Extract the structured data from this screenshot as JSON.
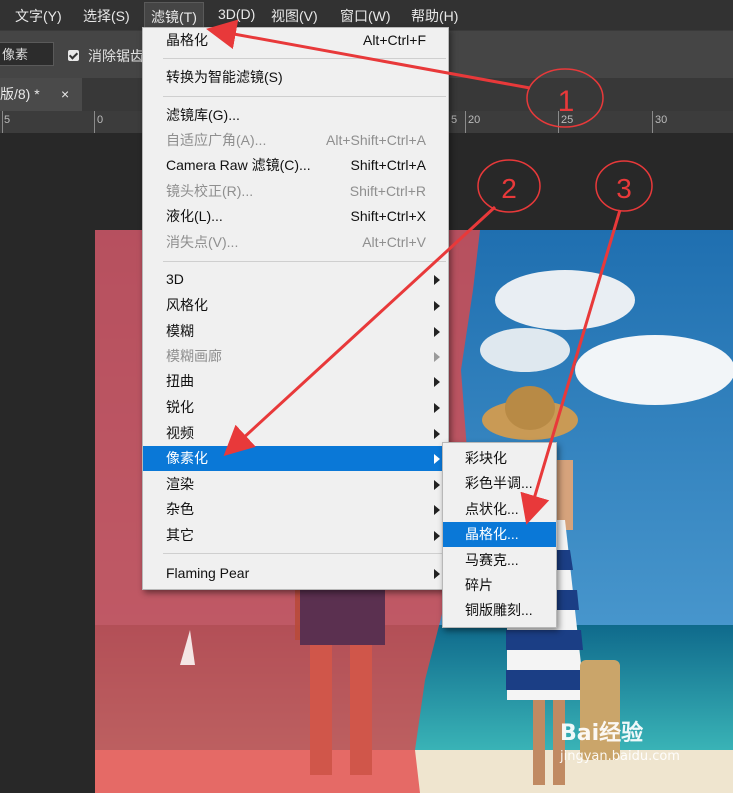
{
  "menubar": {
    "items": [
      "文字(Y)",
      "选择(S)",
      "滤镜(T)",
      "3D(D)",
      "视图(V)",
      "窗口(W)",
      "帮助(H)"
    ]
  },
  "options_bar": {
    "field_value": "像素",
    "checkbox_label": "消除锯齿"
  },
  "document_tab": {
    "title": "版/8) *",
    "close": "×"
  },
  "ruler": {
    "labels": [
      "5",
      "0",
      "5",
      "20",
      "25",
      "30"
    ]
  },
  "filter_menu": {
    "items": [
      {
        "label": "晶格化",
        "shortcut": "Alt+Ctrl+F"
      },
      {
        "label": "转换为智能滤镜(S)",
        "shortcut": ""
      },
      {
        "label": "滤镜库(G)...",
        "shortcut": ""
      },
      {
        "label": "自适应广角(A)...",
        "shortcut": "Alt+Shift+Ctrl+A",
        "disabled": true
      },
      {
        "label": "Camera Raw 滤镜(C)...",
        "shortcut": "Shift+Ctrl+A"
      },
      {
        "label": "镜头校正(R)...",
        "shortcut": "Shift+Ctrl+R",
        "disabled": true
      },
      {
        "label": "液化(L)...",
        "shortcut": "Shift+Ctrl+X"
      },
      {
        "label": "消失点(V)...",
        "shortcut": "Alt+Ctrl+V",
        "disabled": true
      },
      {
        "label": "3D",
        "submenu": true
      },
      {
        "label": "风格化",
        "submenu": true
      },
      {
        "label": "模糊",
        "submenu": true
      },
      {
        "label": "模糊画廊",
        "submenu": true,
        "disabled": true
      },
      {
        "label": "扭曲",
        "submenu": true
      },
      {
        "label": "锐化",
        "submenu": true
      },
      {
        "label": "视频",
        "submenu": true
      },
      {
        "label": "像素化",
        "submenu": true,
        "selected": true
      },
      {
        "label": "渲染",
        "submenu": true
      },
      {
        "label": "杂色",
        "submenu": true
      },
      {
        "label": "其它",
        "submenu": true
      },
      {
        "label": "Flaming Pear",
        "submenu": true
      }
    ]
  },
  "pixelate_submenu": {
    "items": [
      {
        "label": "彩块化"
      },
      {
        "label": "彩色半调..."
      },
      {
        "label": "点状化..."
      },
      {
        "label": "晶格化...",
        "selected": true
      },
      {
        "label": "马赛克..."
      },
      {
        "label": "碎片"
      },
      {
        "label": "铜版雕刻..."
      }
    ]
  },
  "annotations": {
    "markers": [
      "1",
      "2",
      "3"
    ],
    "color": "#e8393a"
  },
  "watermark": {
    "logo": "Bai经验",
    "url": "jingyan.baidu.com"
  },
  "colors": {
    "menu_bg": "#f0f0f0",
    "highlight": "#0a78d7",
    "app_bg": "#2b2b2b"
  }
}
